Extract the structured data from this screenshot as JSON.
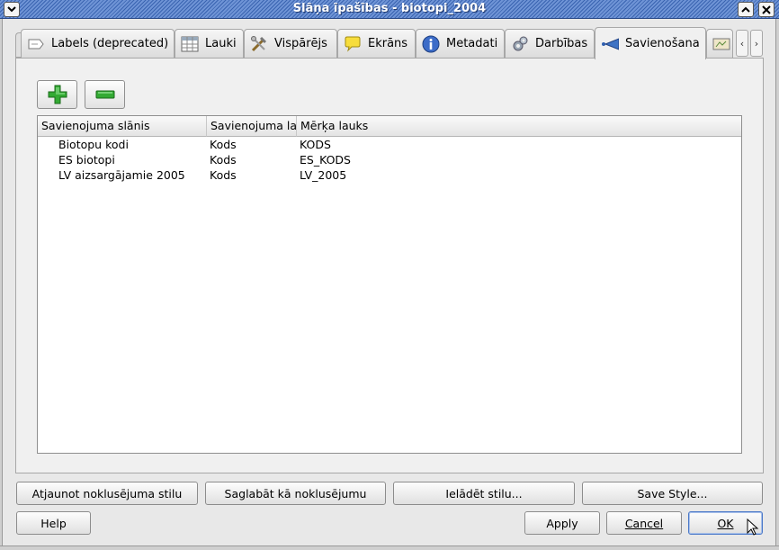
{
  "window": {
    "title": "Slāņa īpašības - biotopi_2004"
  },
  "tabs": [
    {
      "label": "Labels (deprecated)",
      "icon": "labels-icon"
    },
    {
      "label": "Lauki",
      "icon": "table-icon"
    },
    {
      "label": "Vispārējs",
      "icon": "tools-icon"
    },
    {
      "label": "Ekrāns",
      "icon": "speech-bubble-icon"
    },
    {
      "label": "Metadati",
      "icon": "info-icon"
    },
    {
      "label": "Darbības",
      "icon": "gears-icon"
    },
    {
      "label": "Savienošana",
      "icon": "join-icon"
    }
  ],
  "joins": {
    "columns": [
      "Savienojuma slānis",
      "Savienojuma lauks",
      "Mērķa lauks"
    ],
    "rows": [
      [
        "Biotopu kodi",
        "Kods",
        "KODS"
      ],
      [
        "ES biotopi",
        "Kods",
        "ES_KODS"
      ],
      [
        "LV aizsargājamie 2005",
        "Kods",
        "LV_2005"
      ]
    ]
  },
  "style_buttons": {
    "restore": "Atjaunot noklusējuma stilu",
    "save_default": "Saglabāt kā noklusējumu",
    "load": "Ielādēt stilu...",
    "save_style": "Save Style..."
  },
  "dialog_buttons": {
    "help": "Help",
    "apply": "Apply",
    "cancel": "Cancel",
    "ok": "OK"
  },
  "colors": {
    "titlebar": "#4a72c0",
    "add_green": "#2fa02f",
    "selected_tab": "#f0f0f0"
  }
}
